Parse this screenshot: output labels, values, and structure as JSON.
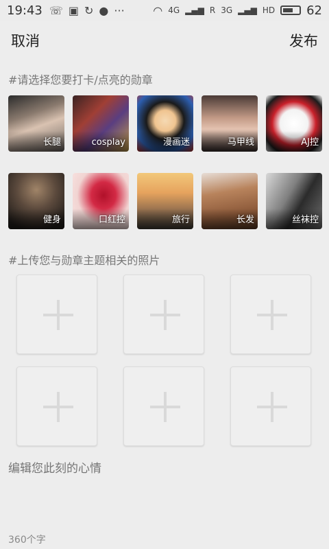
{
  "status_bar": {
    "time": "19:43",
    "network_4g": "4G",
    "network_r": "R",
    "network_3g": "3G",
    "hd": "HD",
    "battery": "62",
    "battery_level": 0.62
  },
  "header": {
    "cancel_label": "取消",
    "publish_label": "发布"
  },
  "badge_section": {
    "title": "#请选择您要打卡/点亮的勋章",
    "items": [
      {
        "label": "长腿",
        "icon": "legs-photo"
      },
      {
        "label": "cosplay",
        "icon": "cosplay-photo"
      },
      {
        "label": "漫画迷",
        "icon": "anime-photo"
      },
      {
        "label": "马甲线",
        "icon": "abs-photo"
      },
      {
        "label": "AJ控",
        "icon": "sneaker-photo"
      },
      {
        "label": "健身",
        "icon": "fitness-photo"
      },
      {
        "label": "口红控",
        "icon": "lipstick-photo"
      },
      {
        "label": "旅行",
        "icon": "travel-photo"
      },
      {
        "label": "长发",
        "icon": "hair-photo"
      },
      {
        "label": "丝袜控",
        "icon": "stockings-photo"
      }
    ]
  },
  "upload_section": {
    "title": "#上传您与勋章主题相关的照片",
    "slot_count": 6
  },
  "mood": {
    "placeholder": "编辑您此刻的心情"
  },
  "counter": "360个字"
}
